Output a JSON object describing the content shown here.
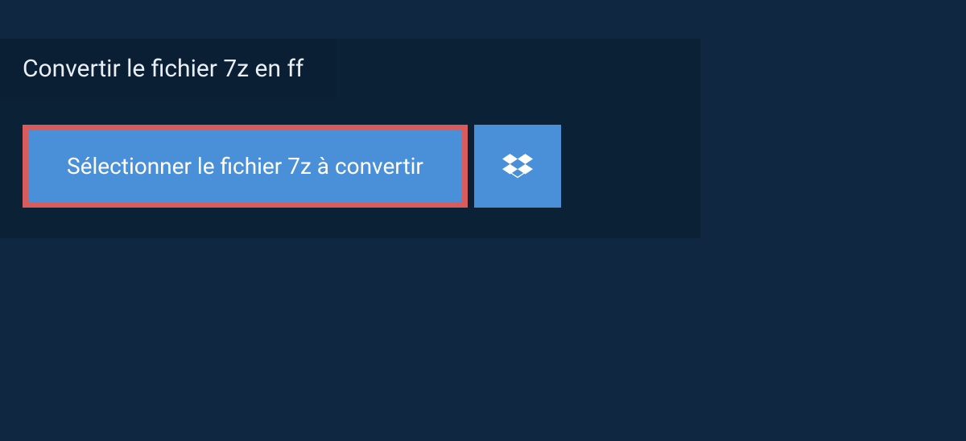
{
  "header": {
    "title": "Convertir le fichier 7z en ff"
  },
  "buttons": {
    "select_file_label": "Sélectionner le fichier 7z à convertir"
  },
  "colors": {
    "background": "#0f2740",
    "panel": "#0a2136",
    "tab": "#0a1f33",
    "button": "#4a90d9",
    "highlight_border": "#d95b5b",
    "text_light": "#e8eef4"
  }
}
